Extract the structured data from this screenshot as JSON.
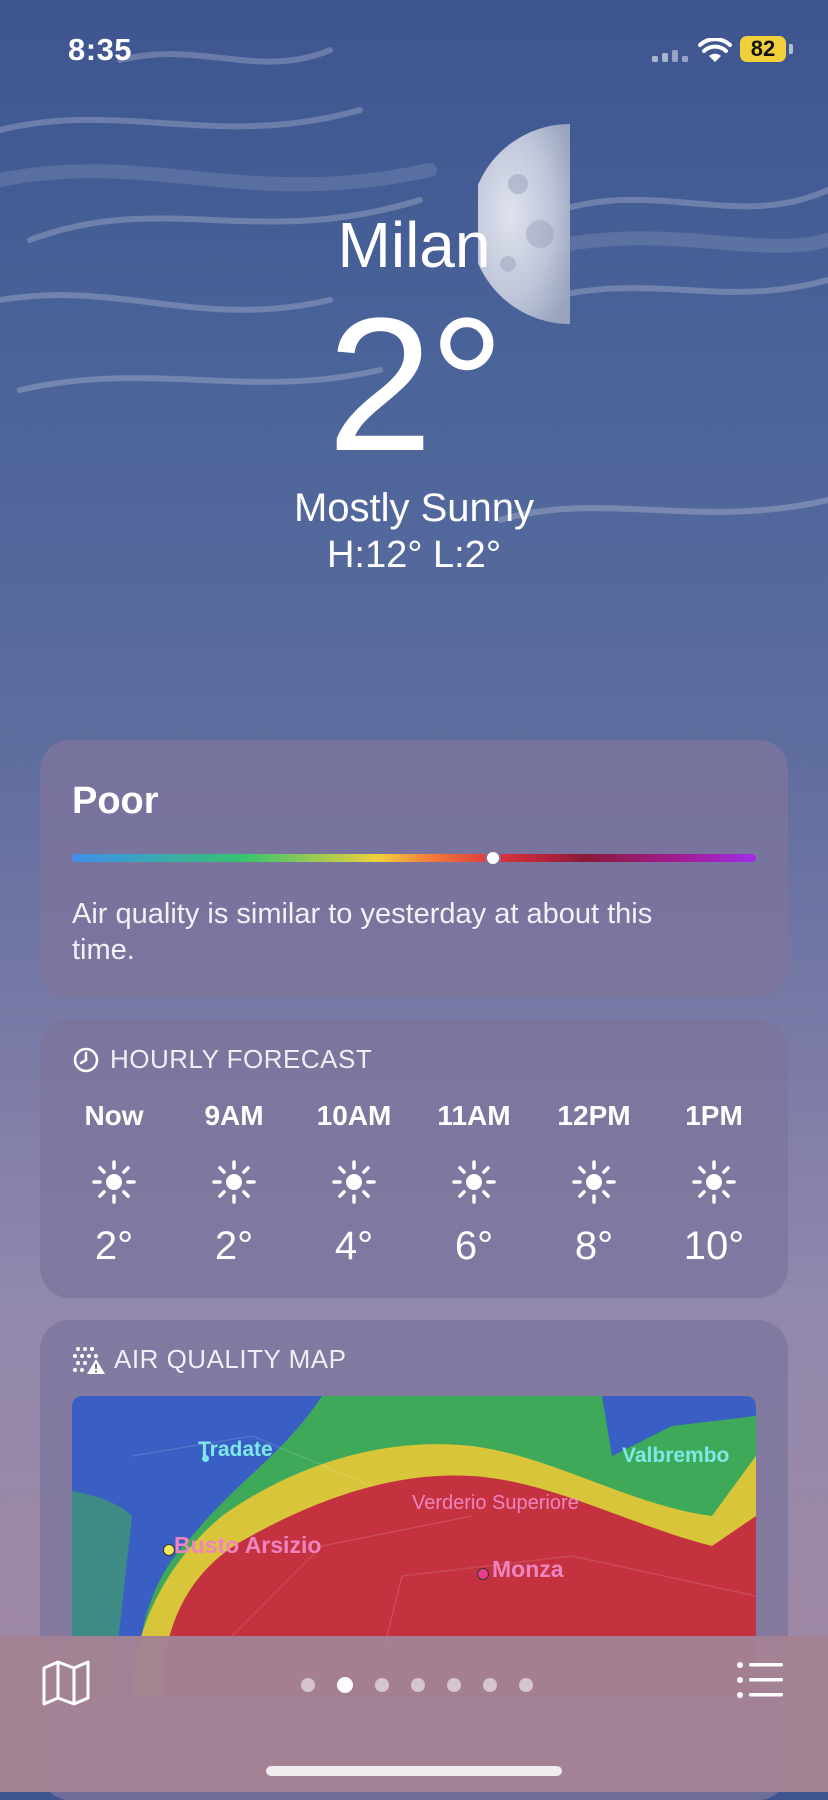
{
  "status_bar": {
    "time": "8:35",
    "battery": "82"
  },
  "location": {
    "city": "Milan",
    "temperature": "2°",
    "condition": "Mostly Sunny",
    "high_low": "H:12°  L:2°"
  },
  "air_quality": {
    "level": "Poor",
    "indicator_fraction": 0.615,
    "description": "Air quality is similar to yesterday at about this time."
  },
  "hourly_forecast": {
    "title": "HOURLY FORECAST",
    "hours": [
      {
        "time": "Now",
        "icon": "sun-icon",
        "temp": "2°"
      },
      {
        "time": "9AM",
        "icon": "sun-icon",
        "temp": "2°"
      },
      {
        "time": "10AM",
        "icon": "sun-icon",
        "temp": "4°"
      },
      {
        "time": "11AM",
        "icon": "sun-icon",
        "temp": "6°"
      },
      {
        "time": "12PM",
        "icon": "sun-icon",
        "temp": "8°"
      },
      {
        "time": "1PM",
        "icon": "sun-icon",
        "temp": "10°"
      }
    ]
  },
  "air_quality_map": {
    "title": "AIR QUALITY MAP",
    "places": {
      "tradate": "Tradate",
      "valbrembo": "Valbrembo",
      "verderio": "Verderio Superiore",
      "busto": "Busto Arsizio",
      "monza": "Monza"
    }
  },
  "bottom_bar": {
    "page_count": 7,
    "active_page": 1
  },
  "colors": {
    "aq_green": "#3fa95a",
    "aq_yellow": "#d9c53a",
    "aq_red": "#c4313f",
    "aq_blue": "#3a5fc4",
    "battery": "#f2d03c"
  }
}
